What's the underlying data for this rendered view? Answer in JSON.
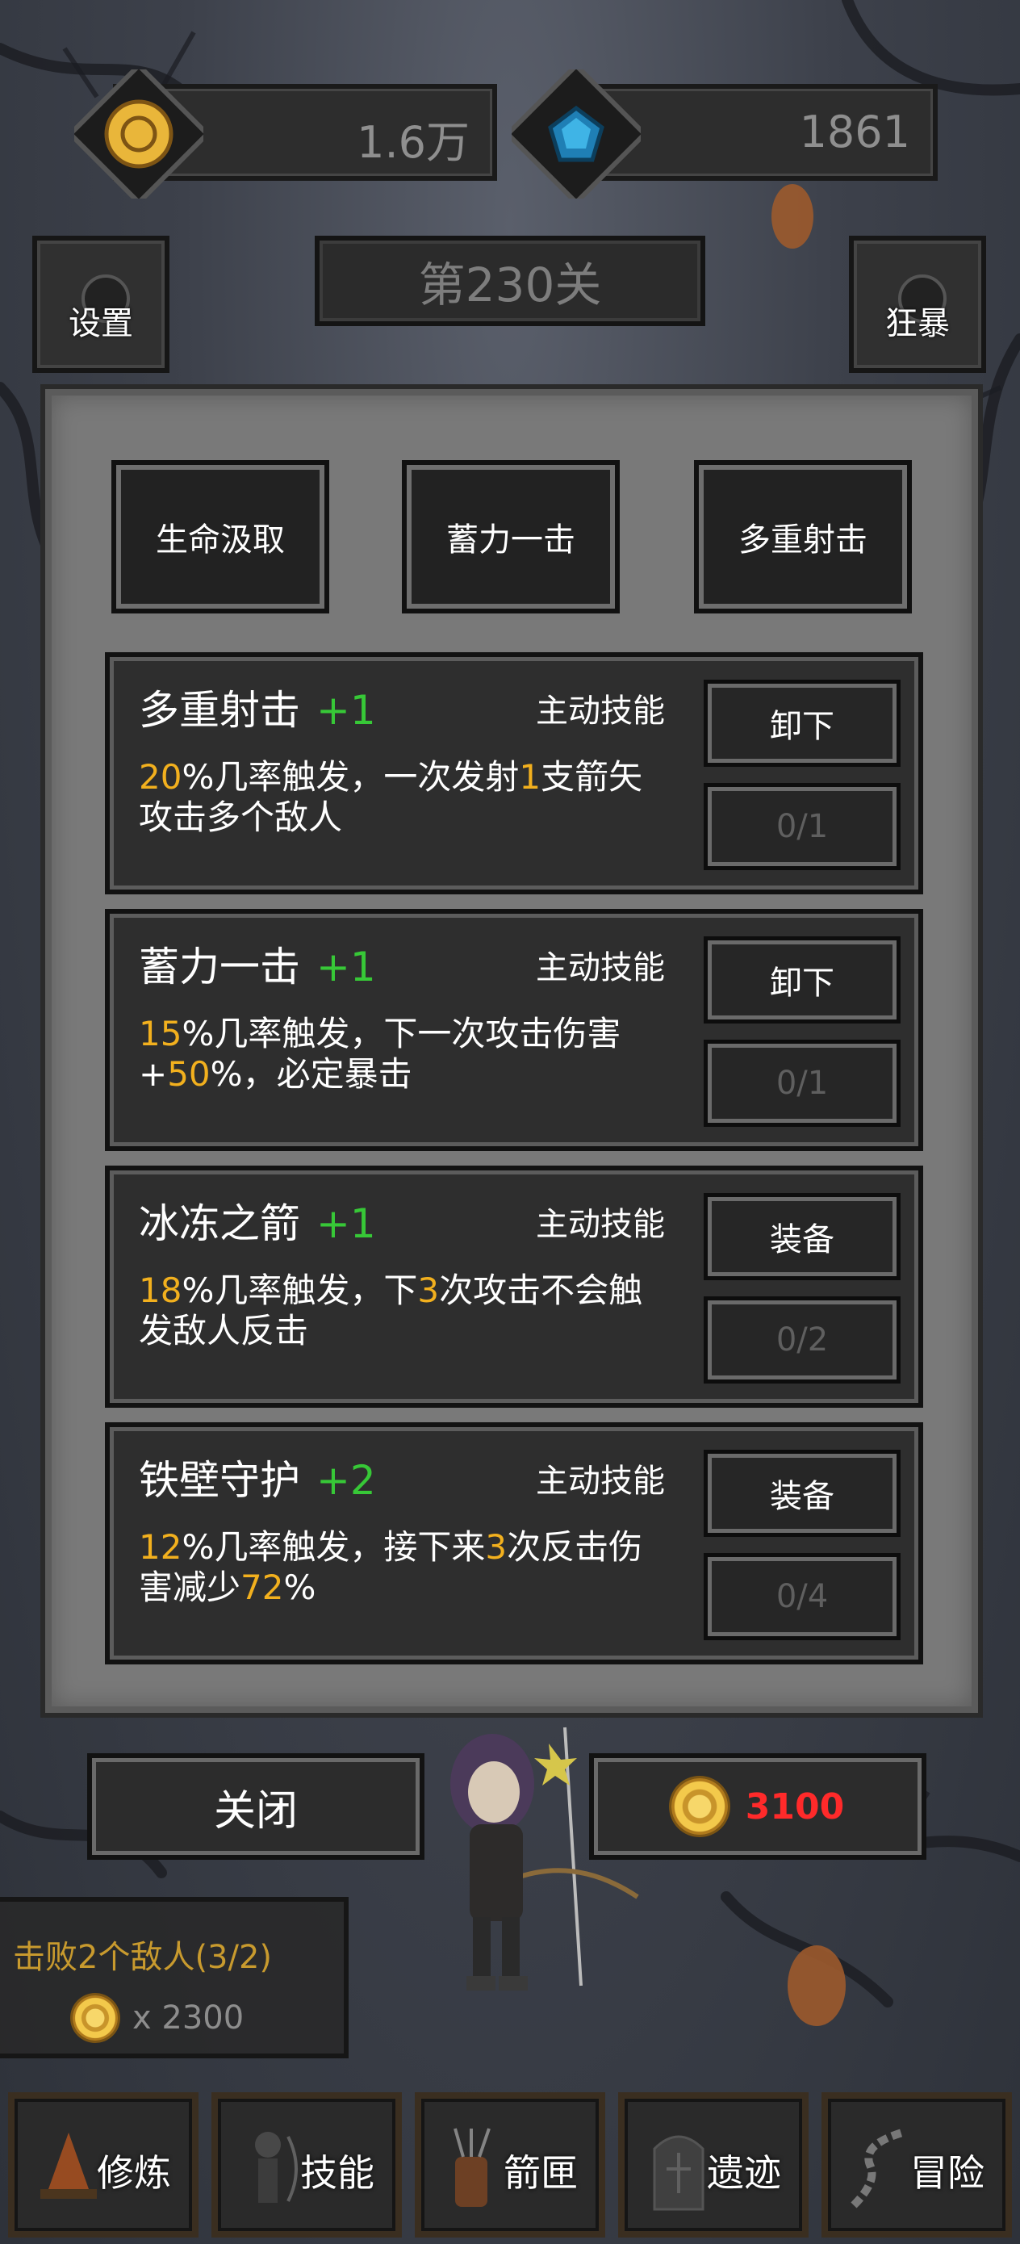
{
  "top_bar": {
    "coins": "1.6万",
    "gems": "1861"
  },
  "level_label": "第230关",
  "side_buttons": {
    "settings_label": "设置",
    "rage_label": "狂暴"
  },
  "skill_slots": [
    {
      "label": "生命汲取"
    },
    {
      "label": "蓄力一击"
    },
    {
      "label": "多重射击"
    }
  ],
  "skill_cards": [
    {
      "name": "多重射击",
      "level": "+1",
      "type": "主动技能",
      "desc_parts": [
        {
          "t": "20",
          "hl": true
        },
        {
          "t": "%几率触发，一次发射",
          "hl": false
        },
        {
          "t": "1",
          "hl": true
        },
        {
          "t": "支箭矢攻击多个敌人",
          "hl": false
        }
      ],
      "action": "卸下",
      "count": "0/1"
    },
    {
      "name": "蓄力一击",
      "level": "+1",
      "type": "主动技能",
      "desc_parts": [
        {
          "t": "15",
          "hl": true
        },
        {
          "t": "%几率触发，下一次攻击伤害+",
          "hl": false
        },
        {
          "t": "50",
          "hl": true
        },
        {
          "t": "%，必定暴击",
          "hl": false
        }
      ],
      "action": "卸下",
      "count": "0/1"
    },
    {
      "name": "冰冻之箭",
      "level": "+1",
      "type": "主动技能",
      "desc_parts": [
        {
          "t": "18",
          "hl": true
        },
        {
          "t": "%几率触发，下",
          "hl": false
        },
        {
          "t": "3",
          "hl": true
        },
        {
          "t": "次攻击不会触发敌人反击",
          "hl": false
        }
      ],
      "action": "装备",
      "count": "0/2"
    },
    {
      "name": "铁壁守护",
      "level": "+2",
      "type": "主动技能",
      "desc_parts": [
        {
          "t": "12",
          "hl": true
        },
        {
          "t": "%几率触发，接下来",
          "hl": false
        },
        {
          "t": "3",
          "hl": true
        },
        {
          "t": "次反击伤害减少",
          "hl": false
        },
        {
          "t": "72",
          "hl": true
        },
        {
          "t": "%",
          "hl": false
        }
      ],
      "action": "装备",
      "count": "0/4"
    }
  ],
  "close_label": "关闭",
  "buy_price": "3100",
  "quest": {
    "text": "击败2个敌人(3/2)",
    "reward": "x 2300"
  },
  "nav": [
    {
      "label": "修炼",
      "icon": "campfire-icon"
    },
    {
      "label": "技能",
      "icon": "archer-icon"
    },
    {
      "label": "箭匣",
      "icon": "quiver-icon"
    },
    {
      "label": "遗迹",
      "icon": "rune-stone-icon"
    },
    {
      "label": "冒险",
      "icon": "path-icon"
    }
  ],
  "colors": {
    "highlight": "#f2b01e",
    "level_green": "#37c837",
    "price_red": "#ff2a2a"
  }
}
